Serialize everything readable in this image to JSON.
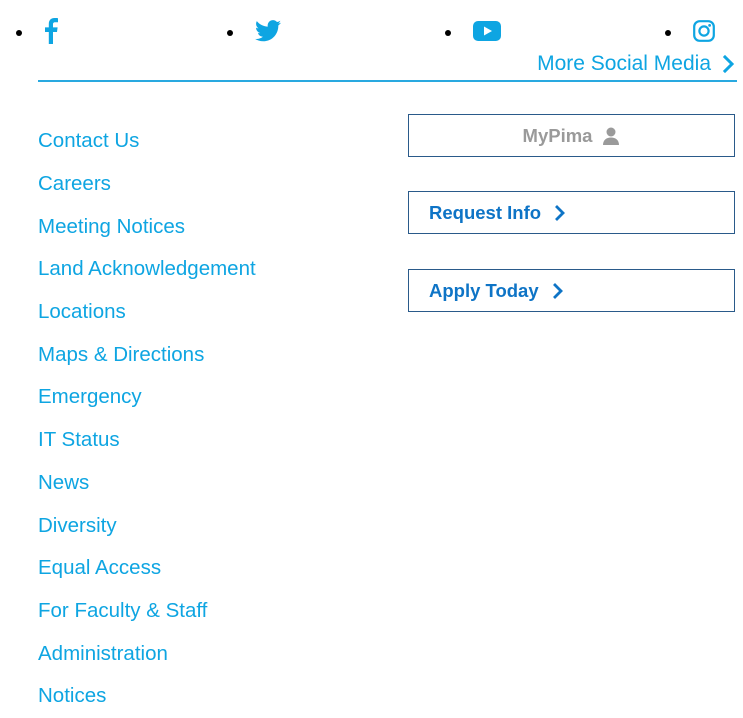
{
  "social": {
    "items": [
      {
        "icon": "facebook-icon"
      },
      {
        "icon": "twitter-icon"
      },
      {
        "icon": "youtube-icon"
      },
      {
        "icon": "instagram-icon"
      }
    ],
    "more_label": "More Social Media"
  },
  "footer_links": [
    "Contact Us",
    "Careers",
    "Meeting Notices",
    "Land Acknowledgement",
    "Locations",
    "Maps & Directions",
    "Emergency",
    "IT Status",
    "News",
    "Diversity",
    "Equal Access",
    "For Faculty & Staff",
    "Administration",
    "Notices"
  ],
  "buttons": {
    "mypima_label": "MyPima",
    "request_label": "Request Info",
    "apply_label": "Apply Today"
  },
  "colors": {
    "link": "#0ea5e2",
    "button_text": "#0e74c6",
    "button_border": "#2a5a8a",
    "mypima_text": "#9a9a9a",
    "divider": "#29a9e0"
  }
}
